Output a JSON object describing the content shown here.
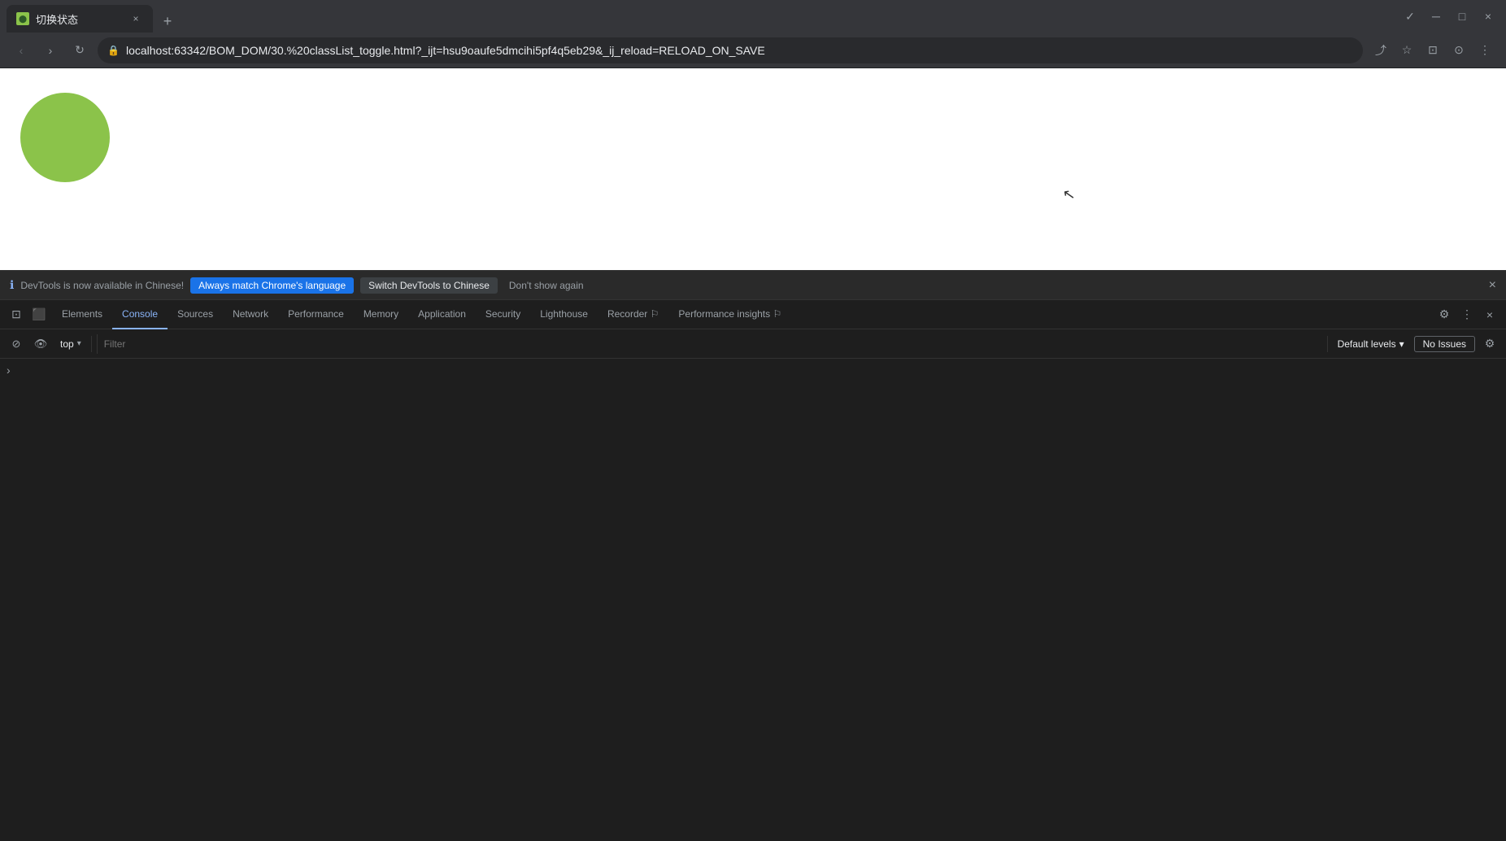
{
  "browser": {
    "tab": {
      "favicon_color": "#8bc34a",
      "title": "切换状态",
      "close_label": "×"
    },
    "new_tab_label": "+",
    "window_controls": {
      "minimize": "─",
      "maximize": "□",
      "close": "×",
      "profile": "⊙",
      "more": "⋮",
      "back_arrow": "‹",
      "forward_arrow": "›",
      "reload": "↻",
      "bookmark": "☆",
      "share": "⤴",
      "extension": "⊡"
    },
    "address_bar": {
      "url": "localhost:63342/BOM_DOM/30.%20classList_toggle.html?_ijt=hsu9oaufe5dmcihi5pf4q5eb29&_ij_reload=RELOAD_ON_SAVE",
      "icon": "🔒"
    }
  },
  "page": {
    "background": "#ffffff",
    "circle": {
      "color": "#8bc34a",
      "size": 110
    }
  },
  "devtools": {
    "notification": {
      "icon": "ℹ",
      "text": "DevTools is now available in Chinese!",
      "btn_always": "Always match Chrome's language",
      "btn_switch": "Switch DevTools to Chinese",
      "btn_dismiss": "Don't show again",
      "close": "×"
    },
    "tabs": [
      {
        "id": "elements",
        "label": "Elements",
        "active": false
      },
      {
        "id": "console",
        "label": "Console",
        "active": true
      },
      {
        "id": "sources",
        "label": "Sources",
        "active": false
      },
      {
        "id": "network",
        "label": "Network",
        "active": false
      },
      {
        "id": "performance",
        "label": "Performance",
        "active": false
      },
      {
        "id": "memory",
        "label": "Memory",
        "active": false
      },
      {
        "id": "application",
        "label": "Application",
        "active": false
      },
      {
        "id": "security",
        "label": "Security",
        "active": false
      },
      {
        "id": "lighthouse",
        "label": "Lighthouse",
        "active": false
      },
      {
        "id": "recorder",
        "label": "Recorder",
        "active": false
      },
      {
        "id": "performance-insights",
        "label": "Performance insights",
        "active": false
      }
    ],
    "console": {
      "context": "top",
      "filter_placeholder": "Filter",
      "level": "Default levels",
      "issues": "No Issues",
      "prompt_arrow": "›"
    }
  }
}
